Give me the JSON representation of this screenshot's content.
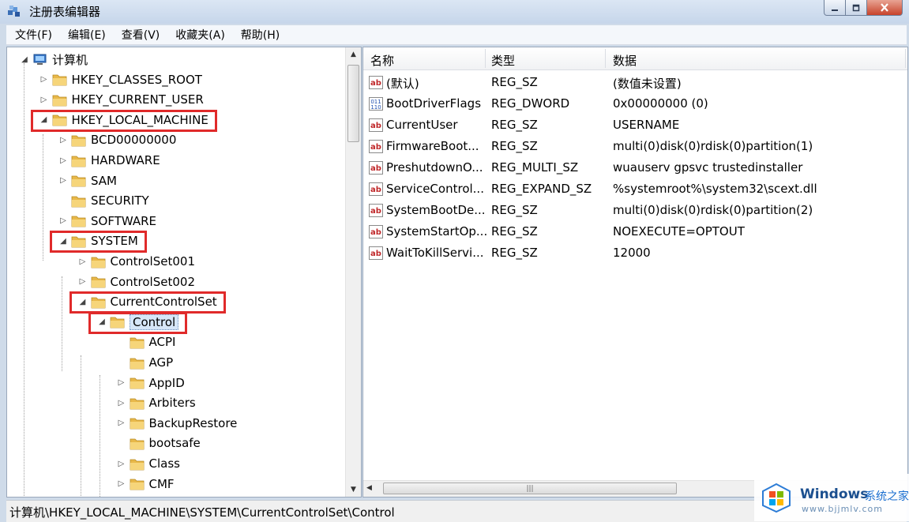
{
  "window": {
    "title": "注册表编辑器"
  },
  "menu": [
    "文件(F)",
    "编辑(E)",
    "查看(V)",
    "收藏夹(A)",
    "帮助(H)"
  ],
  "tree": [
    {
      "label": "计算机",
      "expander": "expanded",
      "icon": "computer-icon",
      "highlight": false,
      "selected": false
    },
    {
      "label": "HKEY_CLASSES_ROOT",
      "expander": "collapsed",
      "icon": "folder-icon",
      "highlight": false,
      "selected": false
    },
    {
      "label": "HKEY_CURRENT_USER",
      "expander": "collapsed",
      "icon": "folder-icon",
      "highlight": false,
      "selected": false
    },
    {
      "label": "HKEY_LOCAL_MACHINE",
      "expander": "expanded",
      "icon": "folder-icon",
      "highlight": true,
      "selected": false
    },
    {
      "label": "BCD00000000",
      "expander": "collapsed",
      "icon": "folder-icon",
      "highlight": false,
      "selected": false
    },
    {
      "label": "HARDWARE",
      "expander": "collapsed",
      "icon": "folder-icon",
      "highlight": false,
      "selected": false
    },
    {
      "label": "SAM",
      "expander": "collapsed",
      "icon": "folder-icon",
      "highlight": false,
      "selected": false
    },
    {
      "label": "SECURITY",
      "expander": "none",
      "icon": "folder-icon",
      "highlight": false,
      "selected": false
    },
    {
      "label": "SOFTWARE",
      "expander": "collapsed",
      "icon": "folder-icon",
      "highlight": false,
      "selected": false
    },
    {
      "label": "SYSTEM",
      "expander": "expanded",
      "icon": "folder-icon",
      "highlight": true,
      "selected": false
    },
    {
      "label": "ControlSet001",
      "expander": "collapsed",
      "icon": "folder-icon",
      "highlight": false,
      "selected": false
    },
    {
      "label": "ControlSet002",
      "expander": "collapsed",
      "icon": "folder-icon",
      "highlight": false,
      "selected": false
    },
    {
      "label": "CurrentControlSet",
      "expander": "expanded",
      "icon": "folder-icon",
      "highlight": true,
      "selected": false
    },
    {
      "label": "Control",
      "expander": "expanded",
      "icon": "folder-icon",
      "highlight": true,
      "selected": true
    },
    {
      "label": "ACPI",
      "expander": "none",
      "icon": "folder-icon",
      "highlight": false,
      "selected": false
    },
    {
      "label": "AGP",
      "expander": "none",
      "icon": "folder-icon",
      "highlight": false,
      "selected": false
    },
    {
      "label": "AppID",
      "expander": "collapsed",
      "icon": "folder-icon",
      "highlight": false,
      "selected": false
    },
    {
      "label": "Arbiters",
      "expander": "collapsed",
      "icon": "folder-icon",
      "highlight": false,
      "selected": false
    },
    {
      "label": "BackupRestore",
      "expander": "collapsed",
      "icon": "folder-icon",
      "highlight": false,
      "selected": false
    },
    {
      "label": "bootsafe",
      "expander": "none",
      "icon": "folder-icon",
      "highlight": false,
      "selected": false
    },
    {
      "label": "Class",
      "expander": "collapsed",
      "icon": "folder-icon",
      "highlight": false,
      "selected": false
    },
    {
      "label": "CMF",
      "expander": "collapsed",
      "icon": "folder-icon",
      "highlight": false,
      "selected": false
    }
  ],
  "list": {
    "columns": [
      "名称",
      "类型",
      "数据"
    ],
    "rows": [
      {
        "name": "(默认)",
        "type": "REG_SZ",
        "data": "(数值未设置)",
        "icon": "string-value-icon"
      },
      {
        "name": "BootDriverFlags",
        "type": "REG_DWORD",
        "data": "0x00000000 (0)",
        "icon": "binary-value-icon"
      },
      {
        "name": "CurrentUser",
        "type": "REG_SZ",
        "data": "USERNAME",
        "icon": "string-value-icon"
      },
      {
        "name": "FirmwareBoot...",
        "type": "REG_SZ",
        "data": "multi(0)disk(0)rdisk(0)partition(1)",
        "icon": "string-value-icon"
      },
      {
        "name": "PreshutdownO...",
        "type": "REG_MULTI_SZ",
        "data": "wuauserv gpsvc trustedinstaller",
        "icon": "string-value-icon"
      },
      {
        "name": "ServiceControl...",
        "type": "REG_EXPAND_SZ",
        "data": "%systemroot%\\system32\\scext.dll",
        "icon": "string-value-icon"
      },
      {
        "name": "SystemBootDe...",
        "type": "REG_SZ",
        "data": "multi(0)disk(0)rdisk(0)partition(2)",
        "icon": "string-value-icon"
      },
      {
        "name": "SystemStartOp...",
        "type": "REG_SZ",
        "data": " NOEXECUTE=OPTOUT",
        "icon": "string-value-icon"
      },
      {
        "name": "WaitToKillServi...",
        "type": "REG_SZ",
        "data": "12000",
        "icon": "string-value-icon"
      }
    ]
  },
  "status": {
    "path": "计算机\\HKEY_LOCAL_MACHINE\\SYSTEM\\CurrentControlSet\\Control"
  },
  "watermark": {
    "title": "Windows",
    "cn": "系统之家",
    "url": "www.bjjmlv.com"
  },
  "colors": {
    "highlight_box": "#e02a2a",
    "folder": "#e8b84a",
    "selection": "#d6e6f8",
    "watermark_blue": "#1b4f8f"
  }
}
